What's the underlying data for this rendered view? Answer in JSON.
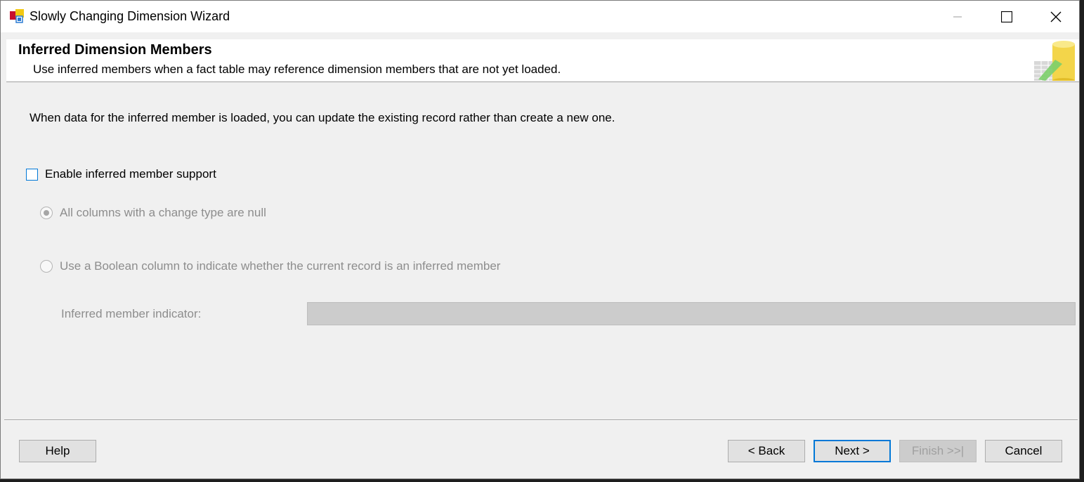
{
  "window": {
    "title": "Slowly Changing Dimension Wizard",
    "icons": {
      "app": "ssis-wizard-icon",
      "minimize": "minimize-icon",
      "maximize": "maximize-icon",
      "close": "close-icon"
    }
  },
  "header": {
    "title": "Inferred Dimension Members",
    "subtitle": "Use inferred members when a fact table may reference dimension members that are not yet loaded.",
    "graphic": "database-cylinder-icon"
  },
  "body": {
    "intro": "When data for the inferred member is loaded, you can update the existing record rather than create a new one.",
    "enable_checkbox": {
      "label": "Enable inferred member support",
      "checked": false
    },
    "options": [
      {
        "label": "All columns with a change type are null",
        "selected": true,
        "enabled": false
      },
      {
        "label": "Use a Boolean column to indicate whether the current record is an inferred member",
        "selected": false,
        "enabled": false
      }
    ],
    "indicator": {
      "label": "Inferred member indicator:",
      "value": "",
      "enabled": false
    }
  },
  "footer": {
    "help": "Help",
    "back": "< Back",
    "next": "Next >",
    "finish": "Finish >>|",
    "cancel": "Cancel"
  },
  "colors": {
    "accent": "#0078d7",
    "window_bg": "#f0f0f0",
    "disabled_text": "#8d8d8d"
  }
}
